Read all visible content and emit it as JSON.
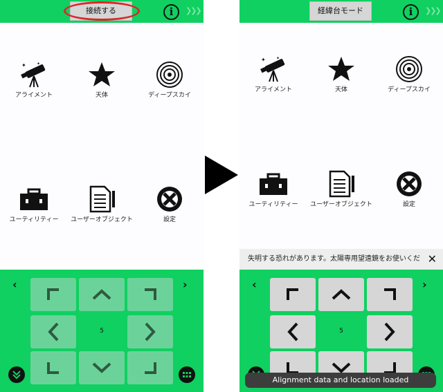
{
  "left_screen": {
    "connect_button": "接続する",
    "menu": [
      {
        "label": "アライメント",
        "icon": "telescope-icon"
      },
      {
        "label": "天体",
        "icon": "star-icon"
      },
      {
        "label": "ディープスカイ",
        "icon": "galaxy-icon"
      },
      {
        "label": "ユーティリティー",
        "icon": "toolbox-icon"
      },
      {
        "label": "ユーザーオブジェクト",
        "icon": "document-icon"
      },
      {
        "label": "設定",
        "icon": "gear-icon"
      }
    ],
    "pad": {
      "speed": "5"
    }
  },
  "right_screen": {
    "mode_button": "経緯台モード",
    "menu": [
      {
        "label": "アライメント",
        "icon": "telescope-icon"
      },
      {
        "label": "天体",
        "icon": "star-icon"
      },
      {
        "label": "ディープスカイ",
        "icon": "galaxy-icon"
      },
      {
        "label": "ユーティリティー",
        "icon": "toolbox-icon"
      },
      {
        "label": "ユーザーオブジェクト",
        "icon": "document-icon"
      },
      {
        "label": "設定",
        "icon": "gear-icon"
      }
    ],
    "notification": "失明する恐れがあります。太陽専用望遠鏡をお使いくだ",
    "pad": {
      "speed": "5"
    },
    "toast": "Alignment data and location loaded"
  },
  "colors": {
    "green": "#0fd060",
    "light_green_btn": "#6bd39a",
    "gray_btn": "#d6d6d6",
    "highlight": "#d62a2a"
  }
}
